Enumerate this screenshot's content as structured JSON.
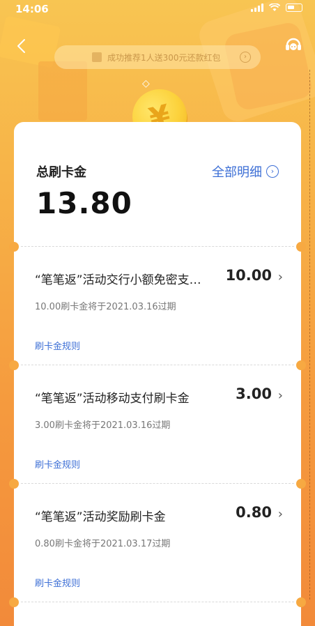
{
  "status_bar": {
    "time": "14:06"
  },
  "promo": {
    "text": "成功推荐1人送300元还款红包",
    "arrow": "›"
  },
  "coin_symbol": "¥",
  "summary": {
    "label": "总刷卡金",
    "amount": "13.80",
    "details_link": "全部明细",
    "details_arrow": "›"
  },
  "items": [
    {
      "title": "“笔笔返”活动交行小额免密支付刷卡金",
      "amount": "10.00",
      "expiry": "10.00刷卡金将于2021.03.16过期",
      "rule_link": "刷卡金规则"
    },
    {
      "title": "“笔笔返”活动移动支付刷卡金",
      "amount": "3.00",
      "expiry": "3.00刷卡金将于2021.03.16过期",
      "rule_link": "刷卡金规则"
    },
    {
      "title": "“笔笔返”活动奖励刷卡金",
      "amount": "0.80",
      "expiry": "0.80刷卡金将于2021.03.17过期",
      "rule_link": "刷卡金规则"
    }
  ],
  "icons": {
    "back": "back-arrow-icon",
    "support": "customer-service-icon",
    "chevron": "›"
  },
  "colors": {
    "accent": "#3d6fd6",
    "bg_top": "#f8c552",
    "bg_bottom": "#f28a3a",
    "coin": "#fcd23c"
  }
}
